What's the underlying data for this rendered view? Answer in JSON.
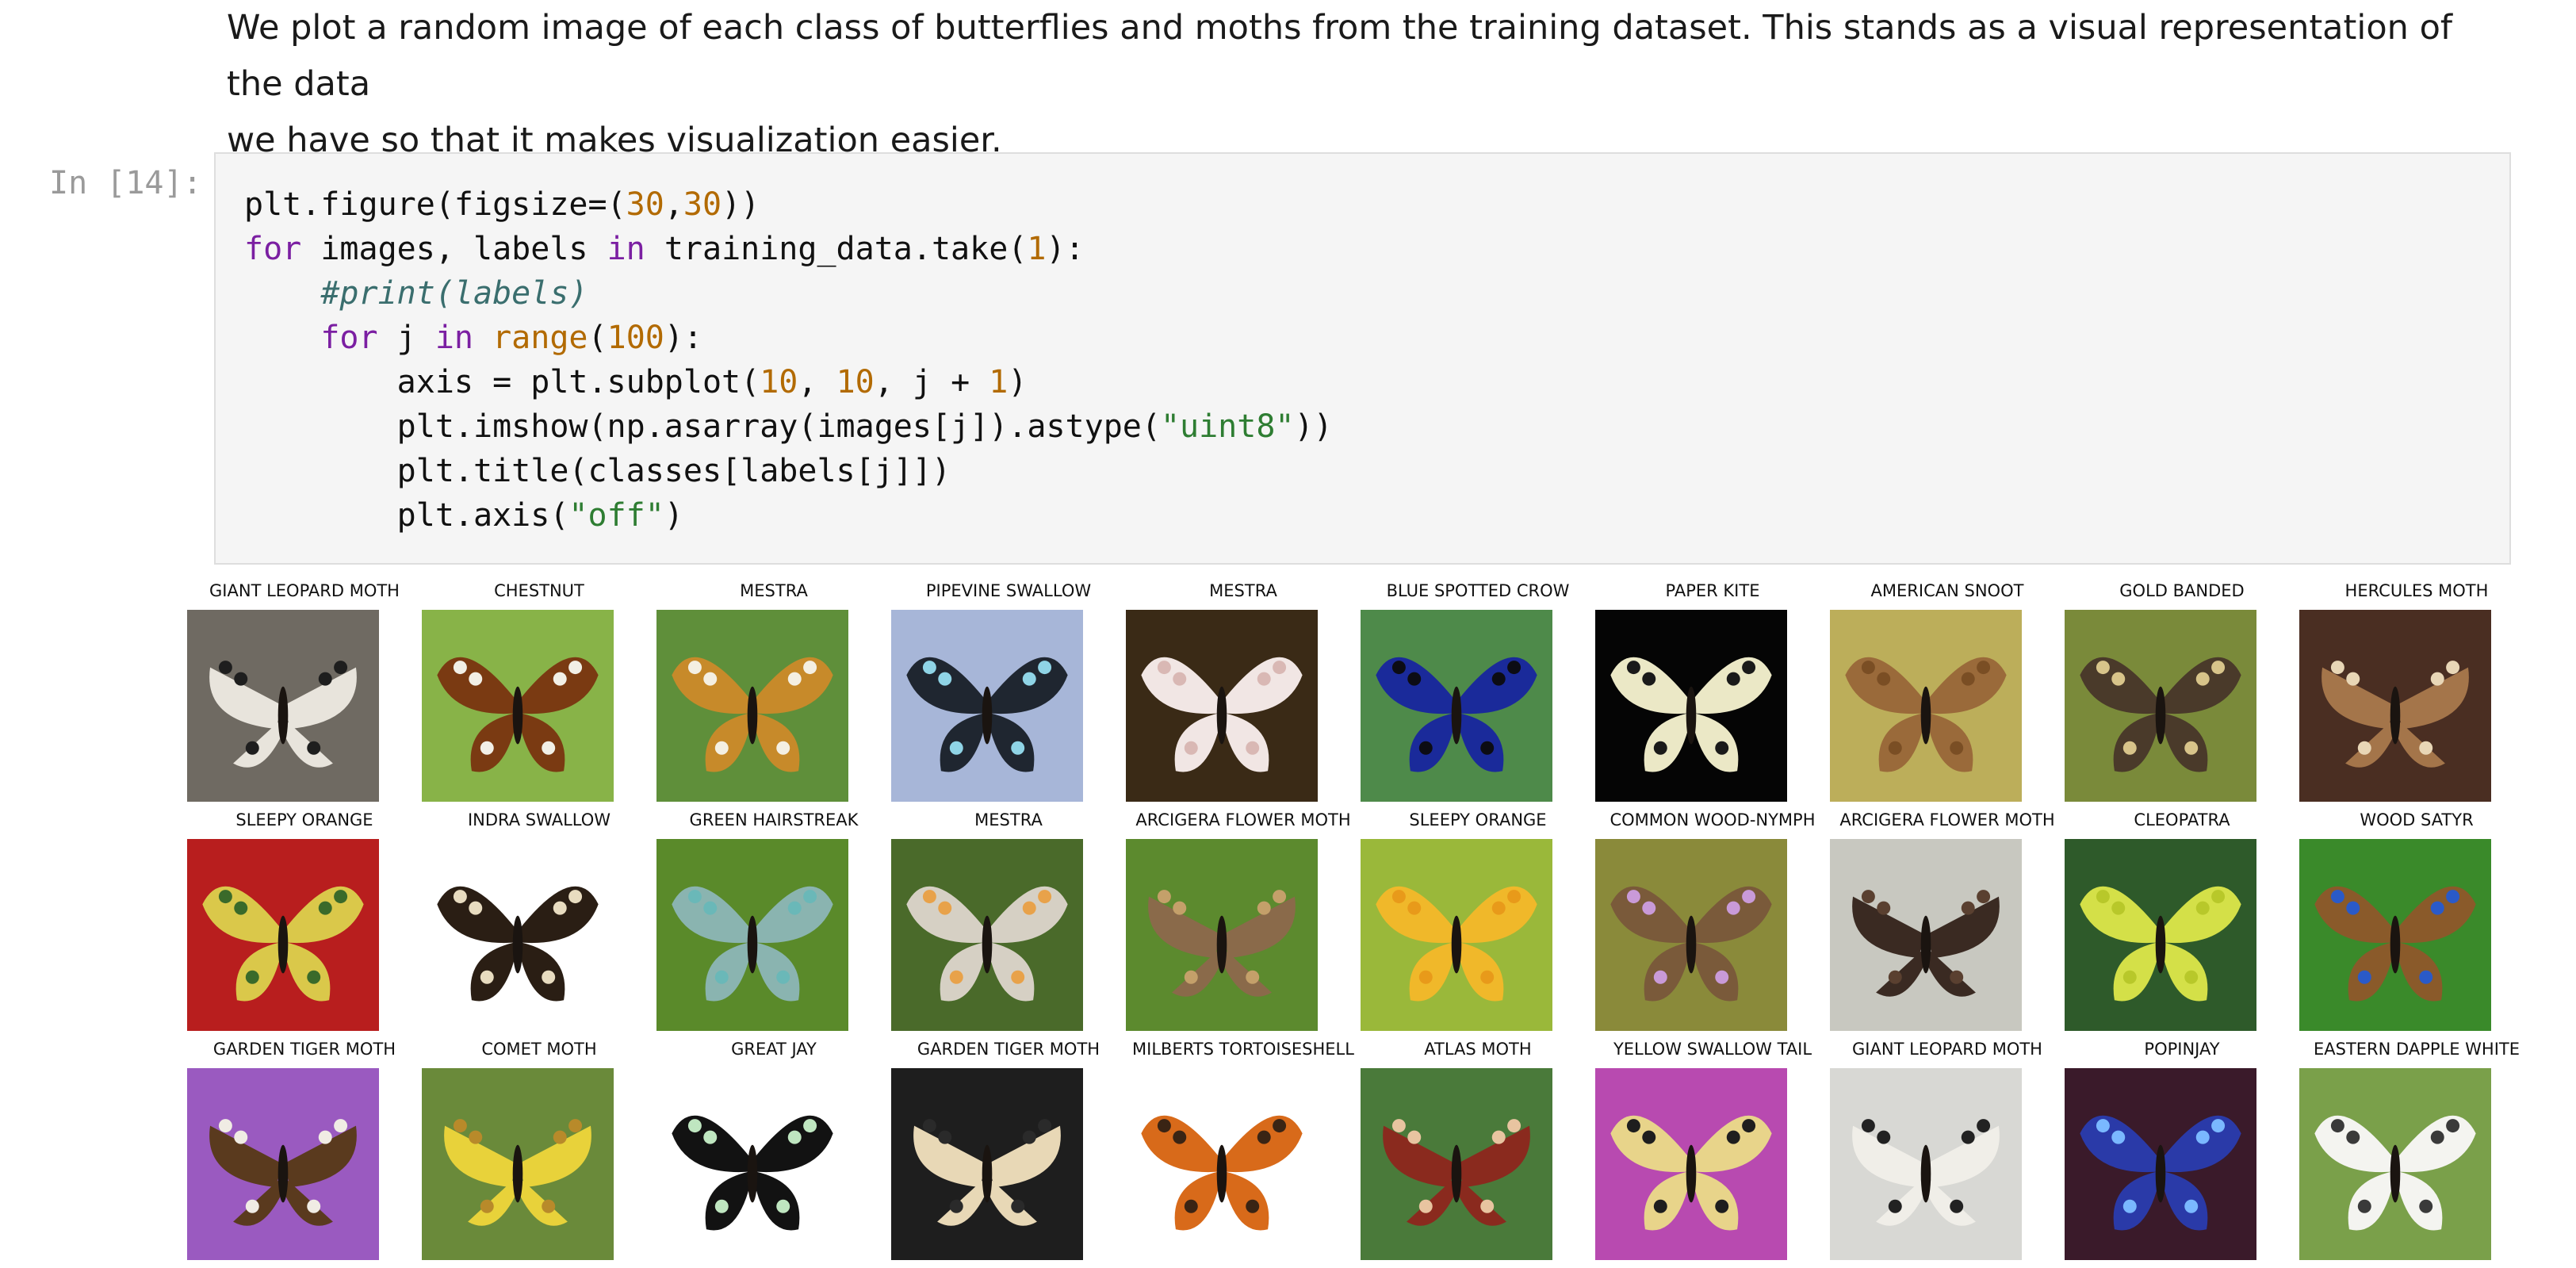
{
  "markdown": {
    "line1": "We plot a random image of each class of butterflies and moths from the training dataset. This stands as a visual representation of the data",
    "line2": "we have so that it makes visualization easier."
  },
  "cell": {
    "prompt": "In [14]:",
    "code_lines": [
      [
        {
          "t": "plt.figure(figsize=(",
          "c": ""
        },
        {
          "t": "30",
          "c": "num"
        },
        {
          "t": ",",
          "c": ""
        },
        {
          "t": "30",
          "c": "num"
        },
        {
          "t": "))",
          "c": ""
        }
      ],
      [
        {
          "t": "for",
          "c": "kw"
        },
        {
          "t": " images, labels ",
          "c": ""
        },
        {
          "t": "in",
          "c": "kw"
        },
        {
          "t": " training_data.take(",
          "c": ""
        },
        {
          "t": "1",
          "c": "num"
        },
        {
          "t": "):",
          "c": ""
        }
      ],
      [
        {
          "t": "    ",
          "c": ""
        },
        {
          "t": "#print(labels)",
          "c": "com"
        }
      ],
      [
        {
          "t": "    ",
          "c": ""
        },
        {
          "t": "for",
          "c": "kw"
        },
        {
          "t": " j ",
          "c": ""
        },
        {
          "t": "in",
          "c": "kw"
        },
        {
          "t": " ",
          "c": ""
        },
        {
          "t": "range",
          "c": "bi"
        },
        {
          "t": "(",
          "c": ""
        },
        {
          "t": "100",
          "c": "num"
        },
        {
          "t": "):",
          "c": ""
        }
      ],
      [
        {
          "t": "        axis = plt.subplot(",
          "c": ""
        },
        {
          "t": "10",
          "c": "num"
        },
        {
          "t": ", ",
          "c": ""
        },
        {
          "t": "10",
          "c": "num"
        },
        {
          "t": ", j + ",
          "c": ""
        },
        {
          "t": "1",
          "c": "num"
        },
        {
          "t": ")",
          "c": ""
        }
      ],
      [
        {
          "t": "        plt.imshow(np.asarray(images[j]).astype(",
          "c": ""
        },
        {
          "t": "\"uint8\"",
          "c": "str"
        },
        {
          "t": "))",
          "c": ""
        }
      ],
      [
        {
          "t": "        plt.title(classes[labels[j]])",
          "c": ""
        }
      ],
      [
        {
          "t": "        plt.axis(",
          "c": ""
        },
        {
          "t": "\"off\"",
          "c": "str"
        },
        {
          "t": ")",
          "c": ""
        }
      ]
    ]
  },
  "output": {
    "tiles": [
      {
        "title": "GIANT LEOPARD MOTH",
        "bg": "#6f6a62",
        "wing": "#e8e4dc",
        "accent": "#1e1e1e",
        "icon": "moth-photo"
      },
      {
        "title": "CHESTNUT",
        "bg": "#88b348",
        "wing": "#7a3a12",
        "accent": "#f2efe6",
        "icon": "butterfly-photo"
      },
      {
        "title": "MESTRA",
        "bg": "#5f8f3a",
        "wing": "#c78a2a",
        "accent": "#f4efe2",
        "icon": "butterfly-photo"
      },
      {
        "title": "PIPEVINE SWALLOW",
        "bg": "#a7b6d8",
        "wing": "#1f2630",
        "accent": "#8fd4e6",
        "icon": "butterfly-photo"
      },
      {
        "title": "MESTRA",
        "bg": "#3a2a16",
        "wing": "#f1e6e4",
        "accent": "#d9b8b4",
        "icon": "butterfly-photo"
      },
      {
        "title": "BLUE SPOTTED CROW",
        "bg": "#4e8a4a",
        "wing": "#1a2a9a",
        "accent": "#0c0c14",
        "icon": "butterfly-photo"
      },
      {
        "title": "PAPER KITE",
        "bg": "#050505",
        "wing": "#ebe8c6",
        "accent": "#1a1a1a",
        "icon": "butterfly-photo"
      },
      {
        "title": "AMERICAN SNOOT",
        "bg": "#bcae5a",
        "wing": "#9a6a3a",
        "accent": "#7a4e24",
        "icon": "butterfly-photo"
      },
      {
        "title": "GOLD BANDED",
        "bg": "#7a8a3a",
        "wing": "#4a3a2a",
        "accent": "#d8c48a",
        "icon": "butterfly-photo"
      },
      {
        "title": "HERCULES MOTH",
        "bg": "#4a2e22",
        "wing": "#a4754a",
        "accent": "#e8d6b6",
        "icon": "moth-photo"
      },
      {
        "title": "SLEEPY ORANGE",
        "bg": "#b81e1e",
        "wing": "#dac84a",
        "accent": "#3a6a2a",
        "icon": "butterfly-photo"
      },
      {
        "title": "INDRA SWALLOW",
        "bg": "#ffffff",
        "wing": "#2a1e14",
        "accent": "#e8dcc0",
        "icon": "butterfly-photo"
      },
      {
        "title": "GREEN HAIRSTREAK",
        "bg": "#5a8a2a",
        "wing": "#8ab4b0",
        "accent": "#6ab8b8",
        "icon": "butterfly-photo"
      },
      {
        "title": "MESTRA",
        "bg": "#4a6a2a",
        "wing": "#d6d0c4",
        "accent": "#e8a24a",
        "icon": "butterfly-photo"
      },
      {
        "title": "ARCIGERA FLOWER MOTH",
        "bg": "#5c8a2e",
        "wing": "#8a6a4a",
        "accent": "#c4a06a",
        "icon": "moth-photo"
      },
      {
        "title": "SLEEPY ORANGE",
        "bg": "#9ab83a",
        "wing": "#f0b82a",
        "accent": "#e89a1a",
        "icon": "butterfly-photo"
      },
      {
        "title": "COMMON WOOD-NYMPH",
        "bg": "#8a8a3a",
        "wing": "#7a5a3a",
        "accent": "#c99ad8",
        "icon": "butterfly-photo"
      },
      {
        "title": "ARCIGERA FLOWER MOTH",
        "bg": "#c8c8c0",
        "wing": "#3a2a22",
        "accent": "#5a4030",
        "icon": "moth-photo"
      },
      {
        "title": "CLEOPATRA",
        "bg": "#2e5a2a",
        "wing": "#d4e048",
        "accent": "#b8c82a",
        "icon": "butterfly-photo"
      },
      {
        "title": "WOOD SATYR",
        "bg": "#3a8a2a",
        "wing": "#8a5a2a",
        "accent": "#2a5ac8",
        "icon": "butterfly-photo"
      },
      {
        "title": "GARDEN TIGER MOTH",
        "bg": "#9a5ac0",
        "wing": "#5a3a1e",
        "accent": "#f0ece4",
        "icon": "moth-photo"
      },
      {
        "title": "COMET MOTH",
        "bg": "#6a8a3a",
        "wing": "#e8d23a",
        "accent": "#b88a2a",
        "icon": "moth-photo"
      },
      {
        "title": "GREAT JAY",
        "bg": "#ffffff",
        "wing": "#121212",
        "accent": "#bfe6c0",
        "icon": "butterfly-photo"
      },
      {
        "title": "GARDEN TIGER MOTH",
        "bg": "#1e1e1e",
        "wing": "#e8d8b6",
        "accent": "#2a2a2a",
        "icon": "moth-photo"
      },
      {
        "title": "MILBERTS TORTOISESHELL",
        "bg": "#ffffff",
        "wing": "#d86a1a",
        "accent": "#3a2414",
        "icon": "butterfly-photo"
      },
      {
        "title": "ATLAS MOTH",
        "bg": "#4a7a3a",
        "wing": "#8a2a1e",
        "accent": "#e8c4a0",
        "icon": "moth-photo"
      },
      {
        "title": "YELLOW SWALLOW TAIL",
        "bg": "#b84ab0",
        "wing": "#e8d48a",
        "accent": "#1e1e1e",
        "icon": "butterfly-photo"
      },
      {
        "title": "GIANT LEOPARD MOTH",
        "bg": "#d8d8d4",
        "wing": "#f0eee8",
        "accent": "#222222",
        "icon": "moth-photo"
      },
      {
        "title": "POPINJAY",
        "bg": "#3a1a2a",
        "wing": "#2a3aa8",
        "accent": "#7ab8ff",
        "icon": "butterfly-photo"
      },
      {
        "title": "EASTERN DAPPLE WHITE",
        "bg": "#7aa04a",
        "wing": "#f4f4f0",
        "accent": "#3a3a3a",
        "icon": "butterfly-photo"
      }
    ]
  }
}
